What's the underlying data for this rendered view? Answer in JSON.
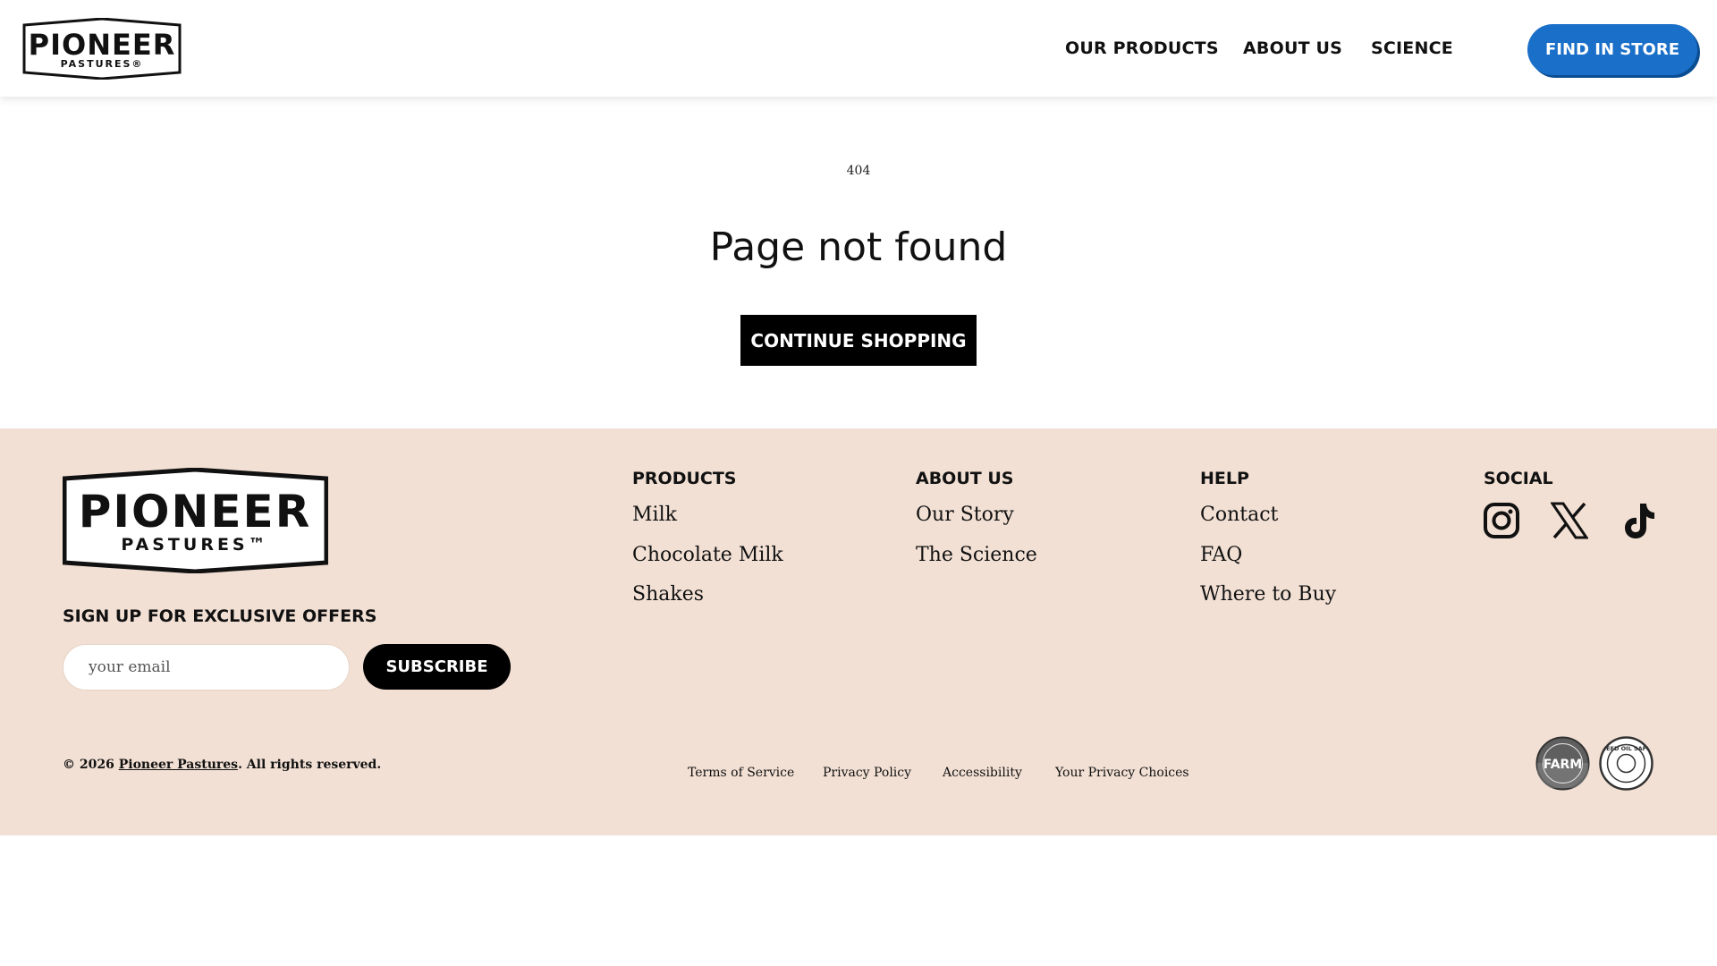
{
  "header": {
    "logo": {
      "line1": "PIONEER",
      "line2": "PASTURES®"
    },
    "nav": [
      "OUR PRODUCTS",
      "ABOUT US",
      "SCIENCE"
    ],
    "cta": "FIND IN STORE"
  },
  "main": {
    "code": "404",
    "title": "Page not found",
    "button": "CONTINUE SHOPPING"
  },
  "footer": {
    "logo": {
      "line1": "PIONEER",
      "line2": "PASTURES™"
    },
    "signup_title": "SIGN UP FOR EXCLUSIVE OFFERS",
    "email_placeholder": "your email",
    "subscribe": "SUBSCRIBE",
    "products": {
      "heading": "PRODUCTS",
      "links": [
        "Milk",
        "Chocolate Milk",
        "Shakes"
      ]
    },
    "about": {
      "heading": "ABOUT US",
      "links": [
        "Our Story",
        "The Science"
      ]
    },
    "help": {
      "heading": "HELP",
      "links": [
        "Contact",
        "FAQ",
        "Where to Buy"
      ]
    },
    "social": {
      "heading": "SOCIAL",
      "icons": [
        "instagram-icon",
        "x-icon",
        "tiktok-icon"
      ]
    },
    "copyright": {
      "prefix": "© 2026 ",
      "brand": "Pioneer Pastures",
      "suffix": ". All rights reserved."
    },
    "legal": [
      "Terms of Service",
      "Privacy Policy",
      "Accessibility",
      "Your Privacy Choices"
    ],
    "badges": [
      {
        "name": "farm-certification-badge",
        "text": "FARM"
      },
      {
        "name": "seed-oil-safe-badge",
        "text": "SEED OIL SAFE"
      }
    ]
  },
  "colors": {
    "accent": "#1a6fc9",
    "footer_bg": "#f2e0d4",
    "text": "#111111"
  }
}
